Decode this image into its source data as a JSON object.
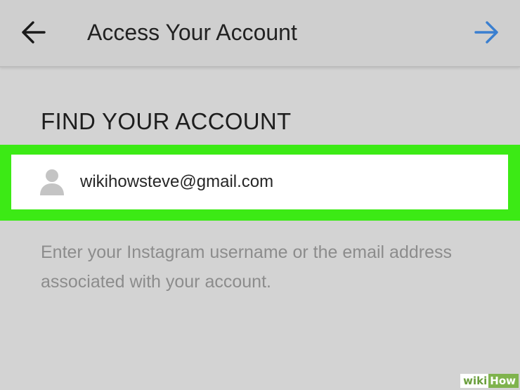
{
  "header": {
    "title": "Access Your Account",
    "back_icon": "arrow-left-icon",
    "next_icon": "arrow-right-icon",
    "next_color": "#3a7fd0"
  },
  "section": {
    "heading": "FIND YOUR ACCOUNT"
  },
  "search": {
    "icon": "user-icon",
    "value": "wikihowsteve@gmail.com",
    "highlight_color": "#3cea15"
  },
  "helper_text": "Enter your Instagram username or the email address associated with your account.",
  "watermark": {
    "part1": "wiki",
    "part2": "How"
  }
}
